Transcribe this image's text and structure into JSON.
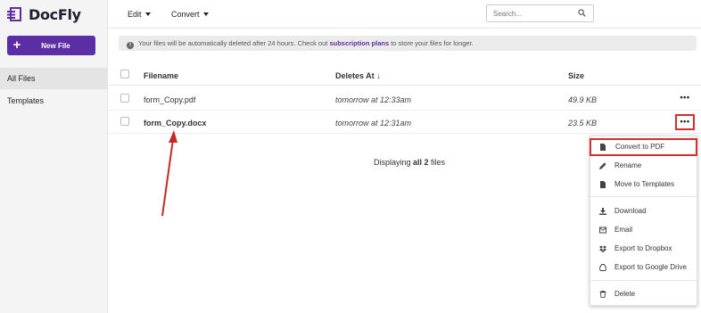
{
  "app": {
    "name": "DocFly",
    "brand_color": "#5b2ea6"
  },
  "sidebar": {
    "new_file_label": "New File",
    "items": [
      {
        "label": "All Files",
        "active": true
      },
      {
        "label": "Templates",
        "active": false
      }
    ]
  },
  "toolbar": {
    "edit_label": "Edit",
    "convert_label": "Convert",
    "search_placeholder": "Search..."
  },
  "notice": {
    "before": "Your files will be automatically deleted after 24 hours. Check out ",
    "link": "subscription plans",
    "after": " to store your files for longer."
  },
  "table": {
    "headers": {
      "filename": "Filename",
      "deletes_at": "Deletes At",
      "size": "Size"
    },
    "rows": [
      {
        "filename": "form_Copy.pdf",
        "deletes_at": "tomorrow at 12:33am",
        "size": "49.9 KB"
      },
      {
        "filename": "form_Copy.docx",
        "deletes_at": "tomorrow at 12:31am",
        "size": "23.5 KB"
      }
    ],
    "footer": {
      "prefix": "Displaying ",
      "bold": "all 2",
      "suffix": " files"
    }
  },
  "context_menu": {
    "items": [
      {
        "label": "Convert to PDF",
        "icon": "file-icon"
      },
      {
        "label": "Rename",
        "icon": "pencil-icon"
      },
      {
        "label": "Move to Templates",
        "icon": "file-icon"
      },
      {
        "label": "Download",
        "icon": "download-icon"
      },
      {
        "label": "Email",
        "icon": "envelope-icon"
      },
      {
        "label": "Export to Dropbox",
        "icon": "dropbox-icon"
      },
      {
        "label": "Export to Google Drive",
        "icon": "google-drive-icon"
      },
      {
        "label": "Delete",
        "icon": "trash-icon"
      }
    ]
  },
  "colors": {
    "highlight": "#d32f2f",
    "accent": "#5b2ea6"
  }
}
